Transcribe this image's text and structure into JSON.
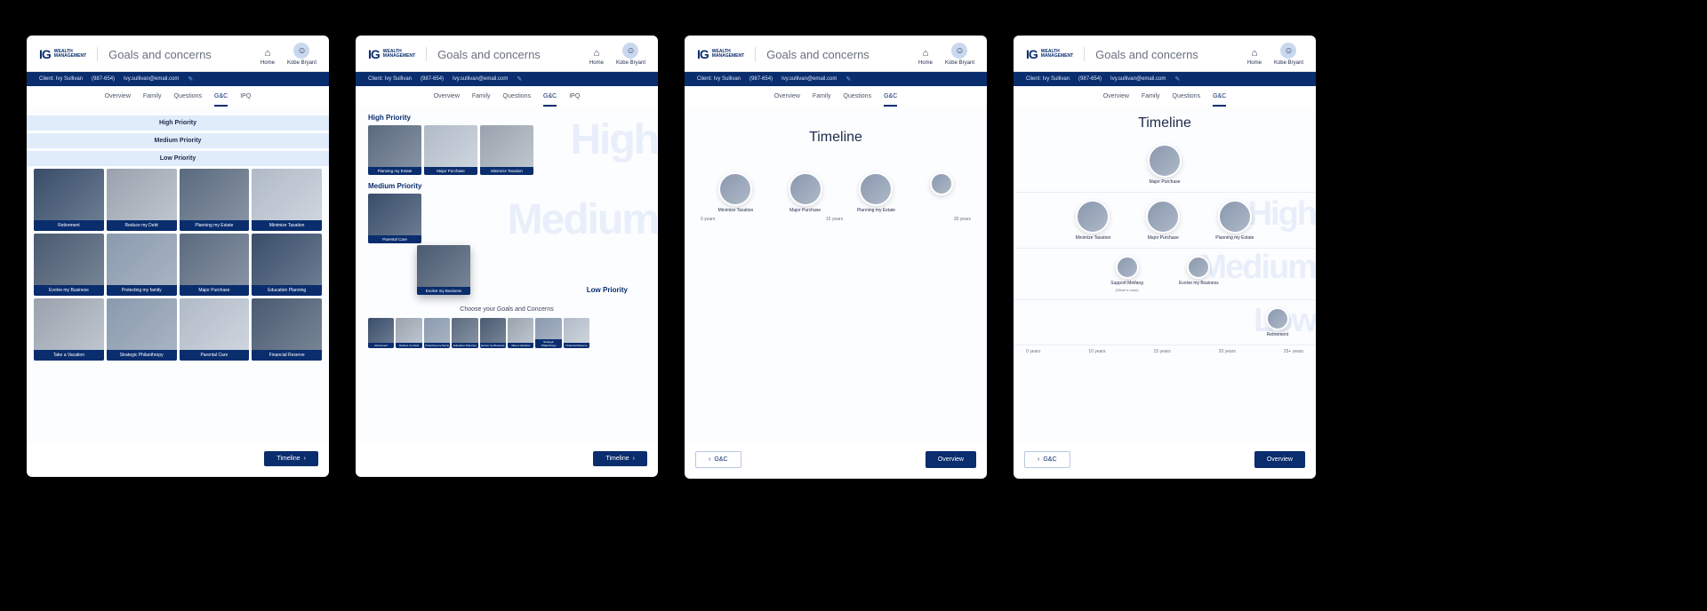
{
  "brand": {
    "mark": "IG",
    "line1": "WEALTH",
    "line2": "MANAGEMENT"
  },
  "pageTitle": "Goals and concerns",
  "home": "Home",
  "user": "Kobe Bryant",
  "client": {
    "label": "Client: Ivy Sullivan",
    "phone": "(987-654)",
    "email": "Ivy.sullivan@email.com"
  },
  "tabs": {
    "overview": "Overview",
    "family": "Family",
    "questions": "Questions",
    "gc": "G&C",
    "ipq": "IPQ"
  },
  "priority": {
    "high": "High Priority",
    "medium": "Medium Priority",
    "low": "Low Priority"
  },
  "goals": {
    "retirement": "Retirement",
    "reduceDebt": "Reduce my Debt",
    "planningEstate": "Planning my Estate",
    "minimizeTaxation": "Minimize Taxation",
    "evolveBusiness": "Evolve my Business",
    "protectingFamily": "Protecting my family",
    "majorPurchase": "Major Purchase",
    "educationPlanning": "Education Planning",
    "takeVacation": "Take a Vacation",
    "strategicPhilanthropy": "Strategic Philanthropy",
    "parentalCare": "Parental Care",
    "financialReserve": "Financial Reserve",
    "supportMeifang": "Support Meifang",
    "supportMeifangSub": "(Oliver's mom)"
  },
  "screen2": {
    "choose": "Choose your Goals and Concerns"
  },
  "ghost": {
    "high": "High",
    "medium": "Medium",
    "low": "Low"
  },
  "timeline": {
    "title": "Timeline",
    "ticks": [
      "0 years",
      "10 years",
      "15 years",
      "20 years",
      "25+ years"
    ],
    "ticks3": [
      "0 years",
      "15 years",
      "30 years"
    ]
  },
  "buttons": {
    "timeline": "Timeline",
    "overview": "Overview",
    "gcBack": "G&C"
  }
}
